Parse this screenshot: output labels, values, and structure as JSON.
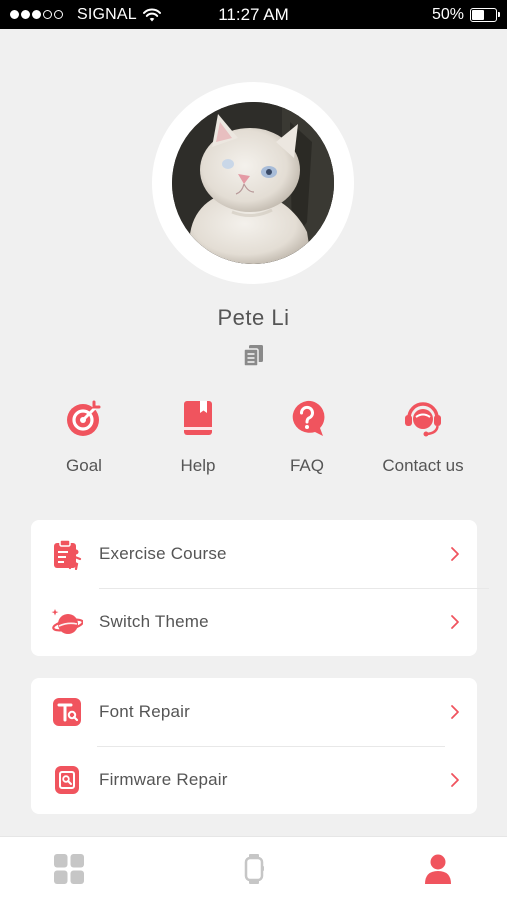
{
  "status_bar": {
    "carrier": "SIGNAL",
    "time": "11:27 AM",
    "battery": "50%",
    "battery_level": 0.5,
    "signal_bars_filled": 3,
    "signal_bars_total": 5
  },
  "profile": {
    "name": "Pete Li"
  },
  "quick_actions": [
    {
      "label": "Goal",
      "icon": "target-icon"
    },
    {
      "label": "Help",
      "icon": "book-icon"
    },
    {
      "label": "FAQ",
      "icon": "question-bubble-icon"
    },
    {
      "label": "Contact us",
      "icon": "headset-icon"
    }
  ],
  "menu_groups": [
    {
      "items": [
        {
          "label": "Exercise Course",
          "icon": "exercise-clipboard-icon"
        },
        {
          "label": "Switch Theme",
          "icon": "planet-icon"
        }
      ]
    },
    {
      "items": [
        {
          "label": "Font Repair",
          "icon": "font-repair-icon"
        },
        {
          "label": "Firmware Repair",
          "icon": "firmware-repair-icon"
        }
      ]
    }
  ],
  "tab_bar": {
    "tabs": [
      {
        "name": "dashboard",
        "icon": "grid-icon",
        "active": false
      },
      {
        "name": "device",
        "icon": "watch-icon",
        "active": false
      },
      {
        "name": "profile",
        "icon": "person-icon",
        "active": true
      }
    ]
  },
  "colors": {
    "accent": "#f0545e",
    "inactive": "#c6c6c6",
    "background": "#f0f0f0"
  }
}
